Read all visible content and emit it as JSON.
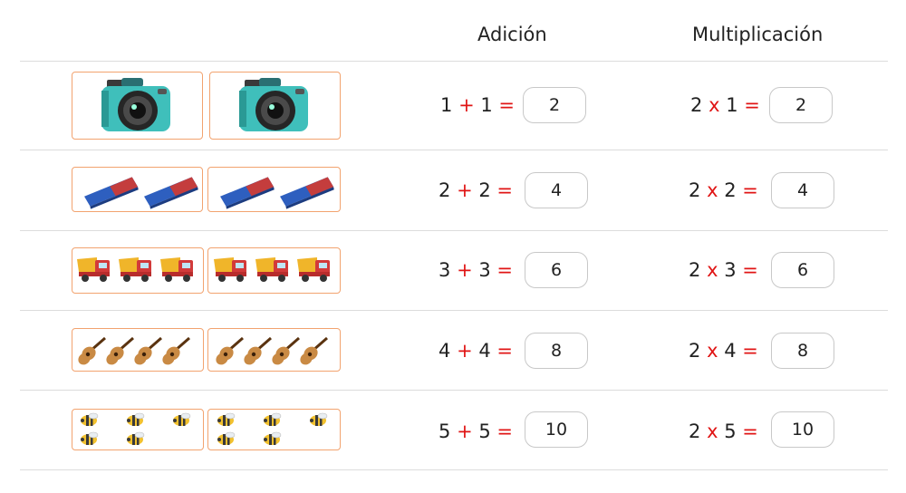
{
  "headers": {
    "addition": "Adición",
    "multiplication": "Multiplicación"
  },
  "rows": [
    {
      "icon": "camera-icon",
      "count": 1,
      "add": {
        "a": "1",
        "op": "+",
        "b": "1",
        "eq": "=",
        "answer": "2"
      },
      "mul": {
        "a": "2",
        "op": "x",
        "b": "1",
        "eq": "=",
        "answer": "2"
      }
    },
    {
      "icon": "eraser-icon",
      "count": 2,
      "add": {
        "a": "2",
        "op": "+",
        "b": "2",
        "eq": "=",
        "answer": "4"
      },
      "mul": {
        "a": "2",
        "op": "x",
        "b": "2",
        "eq": "=",
        "answer": "4"
      }
    },
    {
      "icon": "dump-truck-icon",
      "count": 3,
      "add": {
        "a": "3",
        "op": "+",
        "b": "3",
        "eq": "=",
        "answer": "6"
      },
      "mul": {
        "a": "2",
        "op": "x",
        "b": "3",
        "eq": "=",
        "answer": "6"
      }
    },
    {
      "icon": "guitar-icon",
      "count": 4,
      "add": {
        "a": "4",
        "op": "+",
        "b": "4",
        "eq": "=",
        "answer": "8"
      },
      "mul": {
        "a": "2",
        "op": "x",
        "b": "4",
        "eq": "=",
        "answer": "8"
      }
    },
    {
      "icon": "bee-icon",
      "count": 5,
      "add": {
        "a": "5",
        "op": "+",
        "b": "5",
        "eq": "=",
        "answer": "10"
      },
      "mul": {
        "a": "2",
        "op": "x",
        "b": "5",
        "eq": "=",
        "answer": "10"
      }
    }
  ],
  "colors": {
    "operator": "#e01414",
    "box_border": "#f2a36f",
    "divider": "#dcdcdc"
  }
}
